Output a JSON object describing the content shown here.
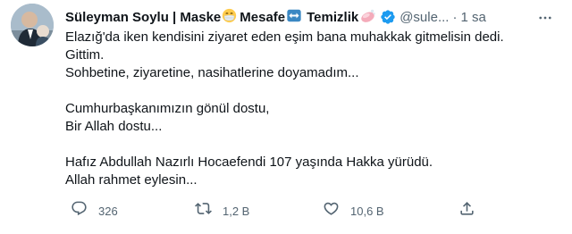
{
  "tweet": {
    "author": {
      "name": "Süleyman Soylu | Maske",
      "name_part2": "Mesafe",
      "name_part3": "Temizlik",
      "handle": "@sule...",
      "time": "1 sa"
    },
    "body_lines": [
      "Elazığ'da iken kendisini ziyaret eden eşim bana muhakkak gitmelisin dedi.",
      "Gittim.",
      "Sohbetine, ziyaretine, nasihatlerine doyamadım...",
      "",
      "Cumhurbaşkanımızın gönül dostu,",
      "Bir Allah dostu...",
      "",
      "Hafız Abdullah Nazırlı Hocaefendi 107 yaşında Hakka yürüdü.",
      "Allah rahmet eylesin..."
    ],
    "actions": {
      "reply_count": "326",
      "retweet_count": "1,2 B",
      "like_count": "10,6 B"
    }
  },
  "colors": {
    "text": "#0f1419",
    "secondary": "#536471",
    "verified": "#1d9bf0"
  },
  "icons": {
    "name_emojis": [
      "mask-emoji",
      "left-right-arrow-emoji",
      "soap-emoji"
    ],
    "action_icons": [
      "reply-icon",
      "retweet-icon",
      "like-icon",
      "share-icon"
    ]
  }
}
